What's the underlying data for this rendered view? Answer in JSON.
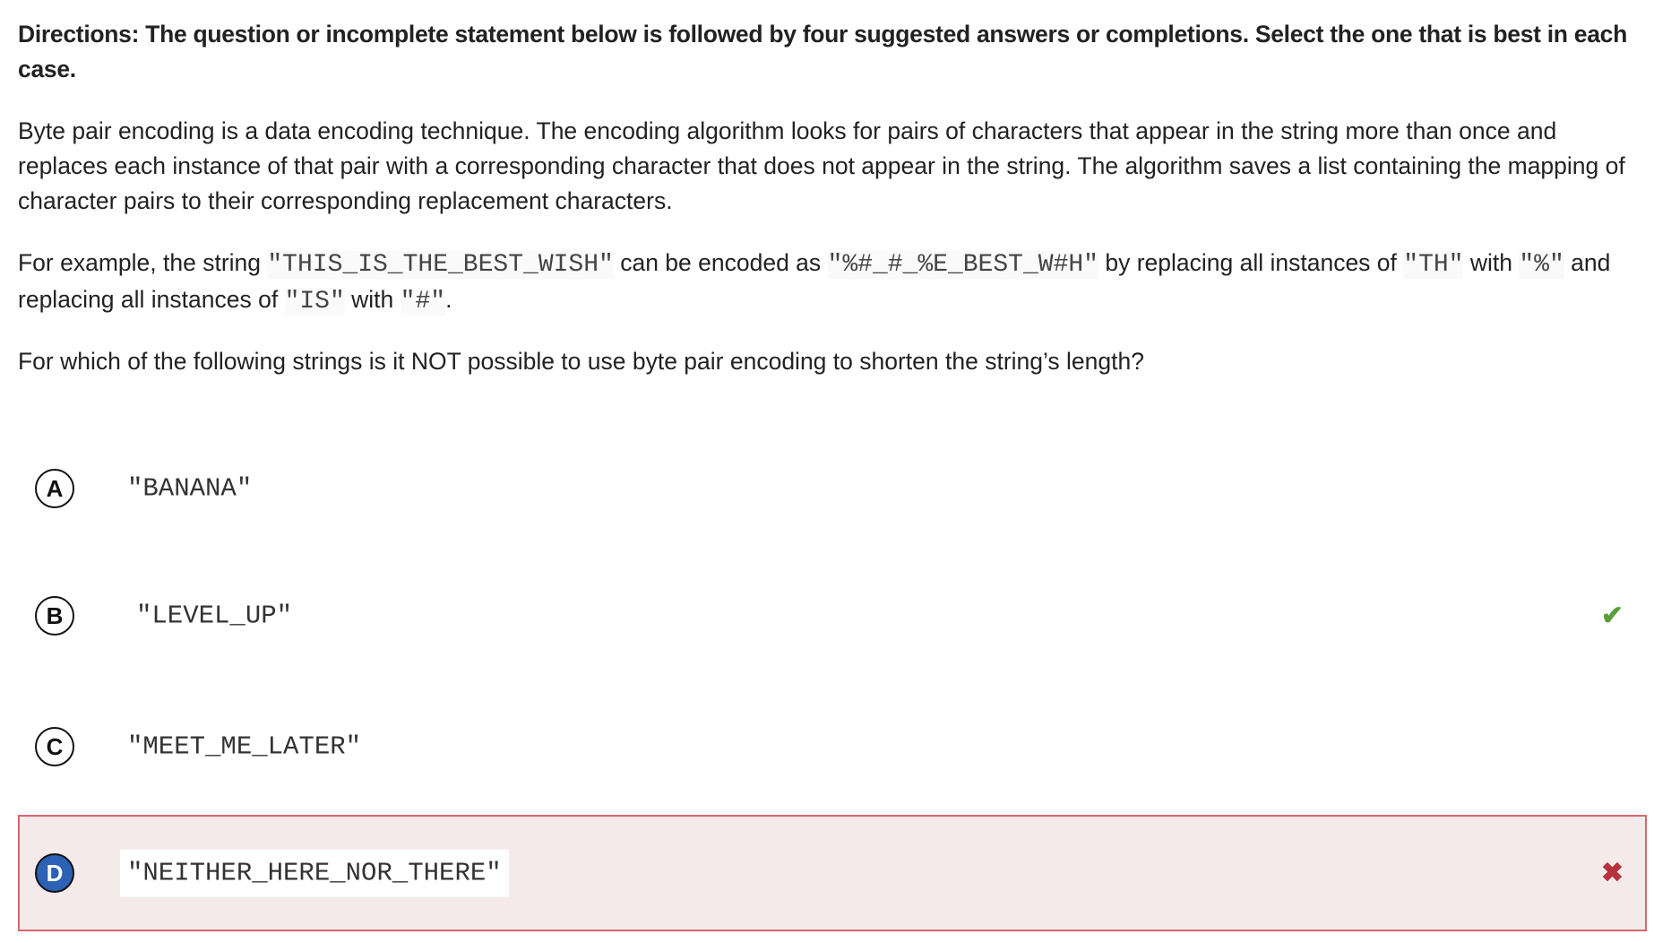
{
  "directions": "Directions: The question or incomplete statement below is followed by four suggested answers or completions. Select the one that is best in each case.",
  "paragraph1": "Byte pair encoding is a data encoding technique. The encoding algorithm looks for pairs of characters that appear in the string more than once and replaces each instance of that pair with a corresponding character that does not appear in the string. The algorithm saves a list containing the mapping of character pairs to their corresponding replacement characters.",
  "paragraph2": {
    "t1": "For example, the string ",
    "c1": "\"THIS_IS_THE_BEST_WISH\"",
    "t2": " can be encoded as ",
    "c2": "\"%#_#_%E_BEST_W#H\"",
    "t3": " by replacing all instances of ",
    "c3": "\"TH\"",
    "t4": " with ",
    "c4": "\"%\"",
    "t5": " and replacing all instances of ",
    "c5": "\"IS\"",
    "t6": " with ",
    "c6": "\"#\"",
    "t7": "."
  },
  "question": "For which of the following strings is it NOT possible to use byte pair encoding to shorten the string’s length?",
  "options": [
    {
      "letter": "A",
      "text": "\"BANANA\""
    },
    {
      "letter": "B",
      "text": "\"LEVEL_UP\"",
      "mark": "✔"
    },
    {
      "letter": "C",
      "text": "\"MEET_ME_LATER\""
    },
    {
      "letter": "D",
      "text": "\"NEITHER_HERE_NOR_THERE\"",
      "mark": "✖",
      "selected": true
    }
  ],
  "colors": {
    "correct": "#5a9e3a",
    "incorrect": "#b5323f",
    "selected_bg": "#f4eaea",
    "selected_border": "#d9646e",
    "selected_circle": "#2b62b5"
  }
}
